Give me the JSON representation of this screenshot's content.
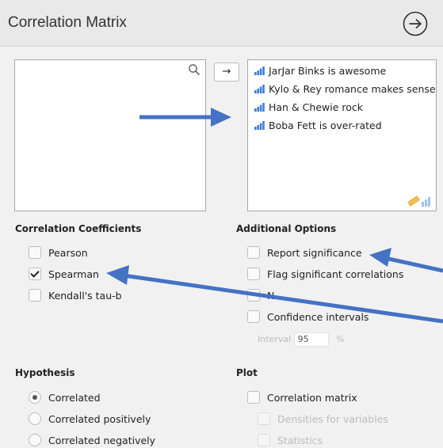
{
  "window": {
    "title": "Correlation Matrix"
  },
  "variables": {
    "items": [
      "JarJar Binks is awesome",
      "Kylo & Rey romance makes sense",
      "Han & Chewie rock",
      "Boba Fett is over-rated"
    ],
    "move_button": "→"
  },
  "coefficients": {
    "title": "Correlation Coefficients",
    "pearson": {
      "label": "Pearson",
      "checked": false
    },
    "spearman": {
      "label": "Spearman",
      "checked": true
    },
    "kendall": {
      "label": "Kendall's tau-b",
      "checked": false
    }
  },
  "additional": {
    "title": "Additional Options",
    "report_significance": "Report significance",
    "flag_significant": "Flag significant correlations",
    "n": "N",
    "confidence_intervals": "Confidence intervals",
    "interval_label": "Interval",
    "interval_value": "95",
    "interval_unit": "%"
  },
  "hypothesis": {
    "title": "Hypothesis",
    "options": [
      "Correlated",
      "Correlated positively",
      "Correlated negatively"
    ],
    "selected": 0
  },
  "plot": {
    "title": "Plot",
    "correlation_matrix": "Correlation matrix",
    "densities": "Densities for variables",
    "statistics": "Statistics"
  },
  "colors": {
    "annotation_arrow": "#4472c4",
    "variable_icon": "#3f7fd6"
  },
  "icons": [
    "arrow-right-circle-icon",
    "search-icon",
    "bar-chart-icon",
    "ruler-icon"
  ]
}
